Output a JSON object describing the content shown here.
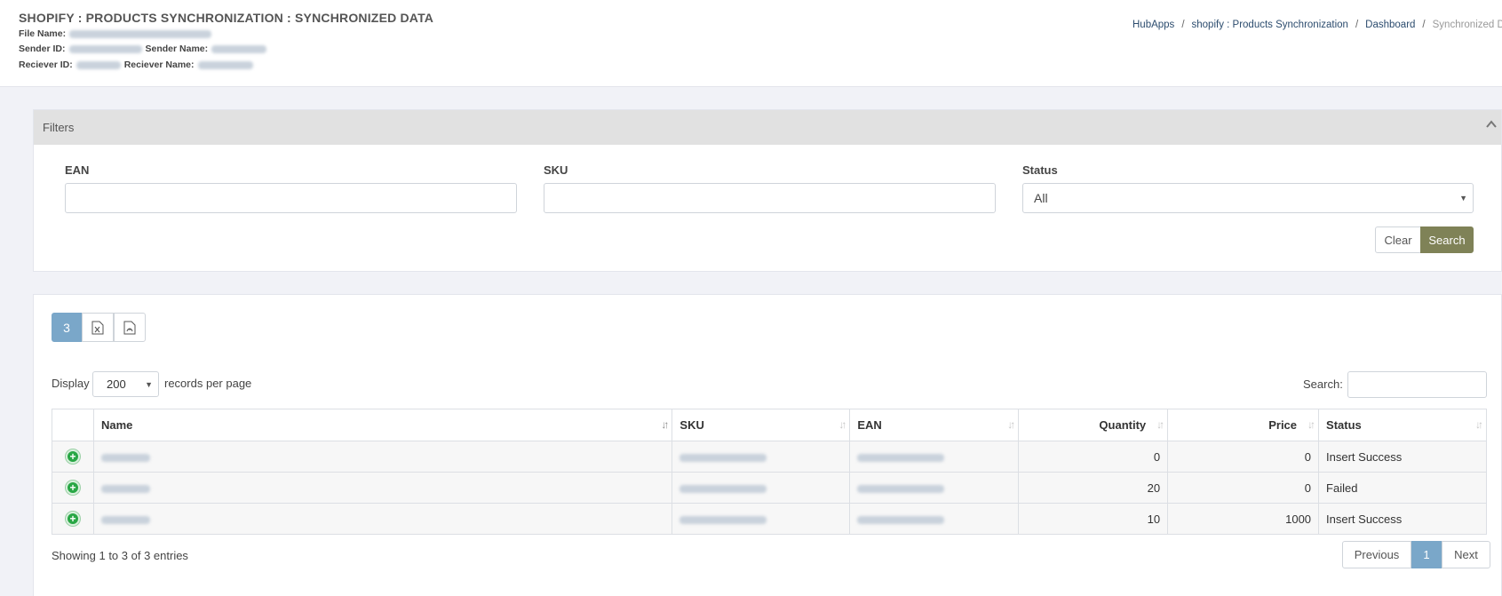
{
  "header": {
    "title": "SHOPIFY : PRODUCTS SYNCHRONIZATION : SYNCHRONIZED DATA",
    "file_name_label": "File Name:",
    "sender_id_label": "Sender ID:",
    "sender_name_label": "Sender Name:",
    "receiver_id_label": "Reciever ID:",
    "receiver_name_label": "Reciever Name:"
  },
  "breadcrumb": {
    "items": [
      "HubApps",
      "shopify : Products Synchronization",
      "Dashboard"
    ],
    "current": "Synchronized D",
    "separator": "/"
  },
  "filters": {
    "title": "Filters",
    "ean_label": "EAN",
    "ean_value": "",
    "sku_label": "SKU",
    "sku_value": "",
    "status_label": "Status",
    "status_value": "All",
    "clear_label": "Clear",
    "search_label": "Search"
  },
  "toolbar": {
    "count": "3"
  },
  "table_controls": {
    "display_label": "Display",
    "page_length": "200",
    "records_label": "records per page",
    "search_label": "Search:"
  },
  "table": {
    "columns": [
      "Name",
      "SKU",
      "EAN",
      "Quantity",
      "Price",
      "Status"
    ],
    "rows": [
      {
        "quantity": "0",
        "price": "0",
        "status": "Insert Success"
      },
      {
        "quantity": "20",
        "price": "0",
        "status": "Failed"
      },
      {
        "quantity": "10",
        "price": "1000",
        "status": "Insert Success"
      }
    ]
  },
  "footer": {
    "info": "Showing 1 to 3 of 3 entries",
    "previous": "Previous",
    "page": "1",
    "next": "Next"
  },
  "colors": {
    "search_button": "#7f8257",
    "active_accent": "#7aa7c9",
    "expand_icon": "#28a745"
  }
}
